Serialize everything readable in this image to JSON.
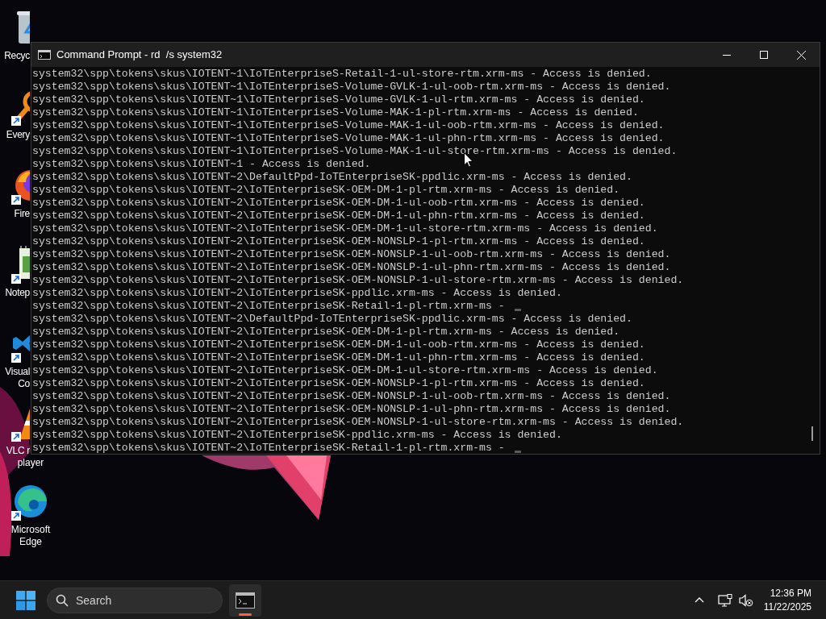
{
  "desktop_icons": [
    {
      "kind": "recycle",
      "shortcut": false,
      "label": [
        "Recyc"
      ]
    },
    {
      "kind": "everything",
      "shortcut": true,
      "label": [
        "Every"
      ]
    },
    {
      "kind": "firefox",
      "shortcut": true,
      "label": [
        "Fire"
      ]
    },
    {
      "kind": "notepad",
      "shortcut": true,
      "label": [
        "Notep"
      ]
    },
    {
      "kind": "vscode",
      "shortcut": true,
      "label": [
        "Visual",
        "Co"
      ]
    },
    {
      "kind": "vlc",
      "shortcut": true,
      "label": [
        "VLC r",
        "player"
      ]
    },
    {
      "kind": "edge",
      "shortcut": true,
      "label": [
        "Microsoft",
        "Edge"
      ]
    }
  ],
  "window": {
    "title": "Command Prompt - rd  /s system32",
    "lines": [
      {
        "text": "system32\\spp\\tokens\\skus\\IOTENT~1\\IoTEnterpriseS-Retail-1-ul-store-rtm.xrm-ms - Access is denied.",
        "cursor": false
      },
      {
        "text": "system32\\spp\\tokens\\skus\\IOTENT~1\\IoTEnterpriseS-Volume-GVLK-1-ul-oob-rtm.xrm-ms - Access is denied.",
        "cursor": false
      },
      {
        "text": "system32\\spp\\tokens\\skus\\IOTENT~1\\IoTEnterpriseS-Volume-GVLK-1-ul-rtm.xrm-ms - Access is denied.",
        "cursor": false
      },
      {
        "text": "system32\\spp\\tokens\\skus\\IOTENT~1\\IoTEnterpriseS-Volume-MAK-1-pl-rtm.xrm-ms - Access is denied.",
        "cursor": false
      },
      {
        "text": "system32\\spp\\tokens\\skus\\IOTENT~1\\IoTEnterpriseS-Volume-MAK-1-ul-oob-rtm.xrm-ms - Access is denied.",
        "cursor": false
      },
      {
        "text": "system32\\spp\\tokens\\skus\\IOTENT~1\\IoTEnterpriseS-Volume-MAK-1-ul-phn-rtm.xrm-ms - Access is denied.",
        "cursor": false
      },
      {
        "text": "system32\\spp\\tokens\\skus\\IOTENT~1\\IoTEnterpriseS-Volume-MAK-1-ul-store-rtm.xrm-ms - Access is denied.",
        "cursor": false
      },
      {
        "text": "system32\\spp\\tokens\\skus\\IOTENT~1 - Access is denied.",
        "cursor": false
      },
      {
        "text": "system32\\spp\\tokens\\skus\\IOTENT~2\\DefaultPpd-IoTEnterpriseSK-ppdlic.xrm-ms - Access is denied.",
        "cursor": false
      },
      {
        "text": "system32\\spp\\tokens\\skus\\IOTENT~2\\IoTEnterpriseSK-OEM-DM-1-pl-rtm.xrm-ms - Access is denied.",
        "cursor": false
      },
      {
        "text": "system32\\spp\\tokens\\skus\\IOTENT~2\\IoTEnterpriseSK-OEM-DM-1-ul-oob-rtm.xrm-ms - Access is denied.",
        "cursor": false
      },
      {
        "text": "system32\\spp\\tokens\\skus\\IOTENT~2\\IoTEnterpriseSK-OEM-DM-1-ul-phn-rtm.xrm-ms - Access is denied.",
        "cursor": false
      },
      {
        "text": "system32\\spp\\tokens\\skus\\IOTENT~2\\IoTEnterpriseSK-OEM-DM-1-ul-store-rtm.xrm-ms - Access is denied.",
        "cursor": false
      },
      {
        "text": "system32\\spp\\tokens\\skus\\IOTENT~2\\IoTEnterpriseSK-OEM-NONSLP-1-pl-rtm.xrm-ms - Access is denied.",
        "cursor": false
      },
      {
        "text": "system32\\spp\\tokens\\skus\\IOTENT~2\\IoTEnterpriseSK-OEM-NONSLP-1-ul-oob-rtm.xrm-ms - Access is denied.",
        "cursor": false
      },
      {
        "text": "system32\\spp\\tokens\\skus\\IOTENT~2\\IoTEnterpriseSK-OEM-NONSLP-1-ul-phn-rtm.xrm-ms - Access is denied.",
        "cursor": false
      },
      {
        "text": "system32\\spp\\tokens\\skus\\IOTENT~2\\IoTEnterpriseSK-OEM-NONSLP-1-ul-store-rtm.xrm-ms - Access is denied.",
        "cursor": false
      },
      {
        "text": "system32\\spp\\tokens\\skus\\IOTENT~2\\IoTEnterpriseSK-ppdlic.xrm-ms - Access is denied.",
        "cursor": false
      },
      {
        "text": "system32\\spp\\tokens\\skus\\IOTENT~2\\IoTEnterpriseSK-Retail-1-pl-rtm.xrm-ms -",
        "cursor": true
      },
      {
        "text": "system32\\spp\\tokens\\skus\\IOTENT~2\\DefaultPpd-IoTEnterpriseSK-ppdlic.xrm-ms - Access is denied.",
        "cursor": false
      },
      {
        "text": "system32\\spp\\tokens\\skus\\IOTENT~2\\IoTEnterpriseSK-OEM-DM-1-pl-rtm.xrm-ms - Access is denied.",
        "cursor": false
      },
      {
        "text": "system32\\spp\\tokens\\skus\\IOTENT~2\\IoTEnterpriseSK-OEM-DM-1-ul-oob-rtm.xrm-ms - Access is denied.",
        "cursor": false
      },
      {
        "text": "system32\\spp\\tokens\\skus\\IOTENT~2\\IoTEnterpriseSK-OEM-DM-1-ul-phn-rtm.xrm-ms - Access is denied.",
        "cursor": false
      },
      {
        "text": "system32\\spp\\tokens\\skus\\IOTENT~2\\IoTEnterpriseSK-OEM-DM-1-ul-store-rtm.xrm-ms - Access is denied.",
        "cursor": false
      },
      {
        "text": "system32\\spp\\tokens\\skus\\IOTENT~2\\IoTEnterpriseSK-OEM-NONSLP-1-pl-rtm.xrm-ms - Access is denied.",
        "cursor": false
      },
      {
        "text": "system32\\spp\\tokens\\skus\\IOTENT~2\\IoTEnterpriseSK-OEM-NONSLP-1-ul-oob-rtm.xrm-ms - Access is denied.",
        "cursor": false
      },
      {
        "text": "system32\\spp\\tokens\\skus\\IOTENT~2\\IoTEnterpriseSK-OEM-NONSLP-1-ul-phn-rtm.xrm-ms - Access is denied.",
        "cursor": false
      },
      {
        "text": "system32\\spp\\tokens\\skus\\IOTENT~2\\IoTEnterpriseSK-OEM-NONSLP-1-ul-store-rtm.xrm-ms - Access is denied.",
        "cursor": false
      },
      {
        "text": "system32\\spp\\tokens\\skus\\IOTENT~2\\IoTEnterpriseSK-ppdlic.xrm-ms - Access is denied.",
        "cursor": false
      },
      {
        "text": "system32\\spp\\tokens\\skus\\IOTENT~2\\IoTEnterpriseSK-Retail-1-pl-rtm.xrm-ms -",
        "cursor": true
      }
    ]
  },
  "taskbar": {
    "search": {
      "placeholder": "Search"
    },
    "apps": [
      {
        "kind": "terminal",
        "running": true
      }
    ],
    "clock": {
      "time": "12:36 PM",
      "date": "11/22/2025"
    }
  }
}
